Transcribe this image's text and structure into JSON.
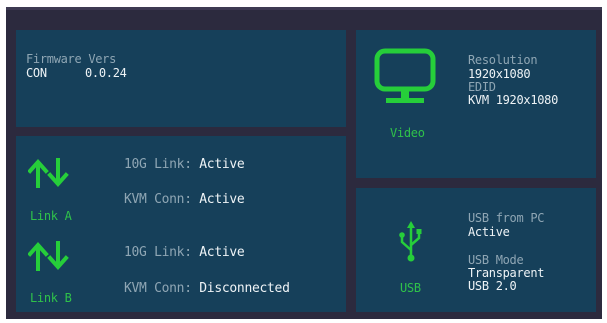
{
  "firmware": {
    "label": "Firmware Vers",
    "module": "CON",
    "version": "0.0.24"
  },
  "links": [
    {
      "name": "Link A",
      "link_label": "10G Link:",
      "link_status": "Active",
      "kvm_label": "KVM Conn:",
      "kvm_status": "Active"
    },
    {
      "name": "Link B",
      "link_label": "10G Link:",
      "link_status": "Active",
      "kvm_label": "KVM Conn:",
      "kvm_status": "Disconnected"
    }
  ],
  "video": {
    "label": "Video",
    "resolution_label": "Resolution",
    "resolution_value": "1920x1080",
    "edid_label": "EDID",
    "edid_value": "KVM 1920x1080"
  },
  "usb": {
    "label": "USB",
    "from_pc_label": "USB from PC",
    "from_pc_value": "Active",
    "mode_label": "USB Mode",
    "mode_value": "Transparent",
    "version": "USB 2.0"
  },
  "colors": {
    "background": "#2c2a3e",
    "panel": "#16405a",
    "accent_green": "#26ce3a",
    "text_light": "#eef3f6",
    "text_dim": "#8fa6b4"
  },
  "icons": {
    "link": "up-down-arrows-icon",
    "video": "monitor-icon",
    "usb": "usb-icon"
  }
}
